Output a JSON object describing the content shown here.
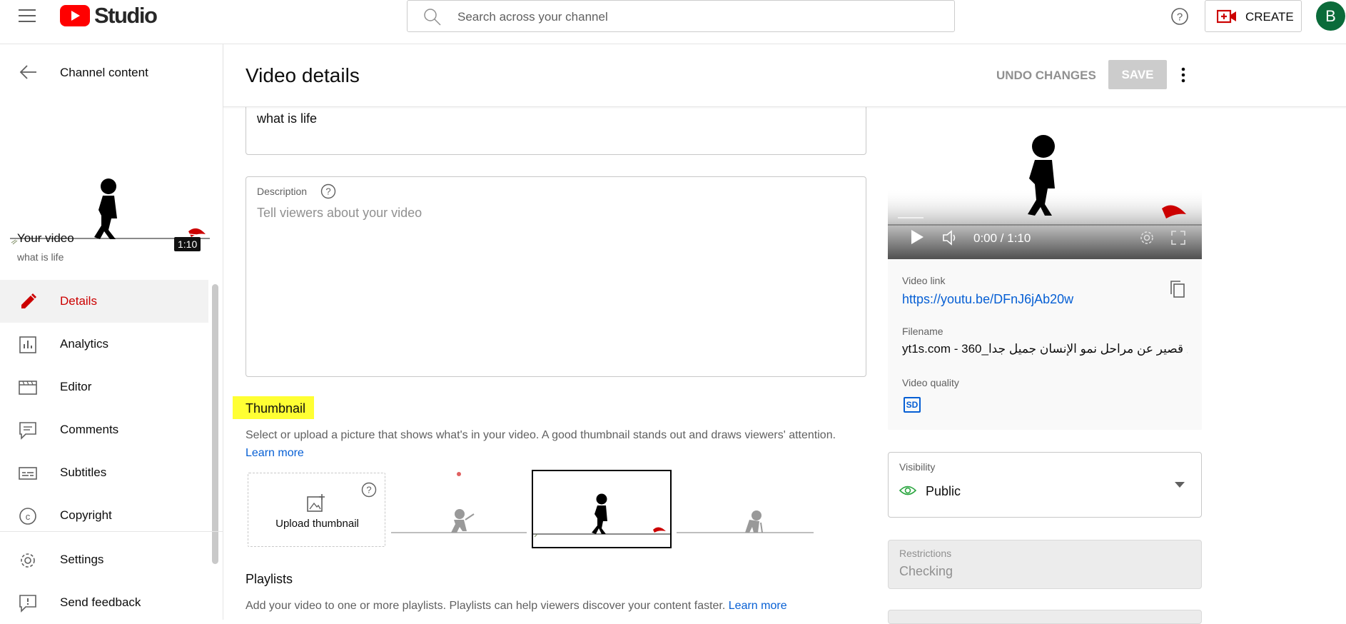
{
  "header": {
    "logo_text": "Studio",
    "search_placeholder": "Search across your channel",
    "create_label": "CREATE",
    "avatar_letter": "B"
  },
  "sidebar": {
    "back_label": "Channel content",
    "video_duration": "1:10",
    "your_video_label": "Your video",
    "video_title": "what is life",
    "items": [
      {
        "label": "Details",
        "icon": "pencil-icon"
      },
      {
        "label": "Analytics",
        "icon": "analytics-icon"
      },
      {
        "label": "Editor",
        "icon": "editor-icon"
      },
      {
        "label": "Comments",
        "icon": "comments-icon"
      },
      {
        "label": "Subtitles",
        "icon": "subtitles-icon"
      },
      {
        "label": "Copyright",
        "icon": "copyright-icon"
      }
    ],
    "footer_items": [
      {
        "label": "Settings",
        "icon": "gear-icon"
      },
      {
        "label": "Send feedback",
        "icon": "feedback-icon"
      }
    ]
  },
  "main": {
    "page_title": "Video details",
    "undo_label": "UNDO CHANGES",
    "save_label": "SAVE",
    "title_value": "what is life",
    "description_label": "Description",
    "description_placeholder": "Tell viewers about your video",
    "thumbnail_heading": "Thumbnail",
    "thumbnail_desc": "Select or upload a picture that shows what's in your video. A good thumbnail stands out and draws viewers' attention.",
    "learn_more": "Learn more",
    "upload_thumbnail_label": "Upload thumbnail",
    "playlists_heading": "Playlists",
    "playlists_desc": "Add your video to one or more playlists. Playlists can help viewers discover your content faster.",
    "playlists_learn_more": "Learn more"
  },
  "right_panel": {
    "player_time": "0:00 / 1:10",
    "video_link_label": "Video link",
    "video_link": "https://youtu.be/DFnJ6jAb20w",
    "filename_label": "Filename",
    "filename": "yt1s.com - 360_ع قصير عن مراحل نمو الإنسان جميل جدا...",
    "quality_label": "Video quality",
    "quality_badge": "SD",
    "visibility_label": "Visibility",
    "visibility_value": "Public",
    "restrictions_label": "Restrictions",
    "restrictions_value": "Checking"
  },
  "colors": {
    "accent_red": "#cc0000",
    "link_blue": "#065fd4",
    "highlight_yellow": "#ffff33",
    "visibility_green": "#2ba640"
  }
}
